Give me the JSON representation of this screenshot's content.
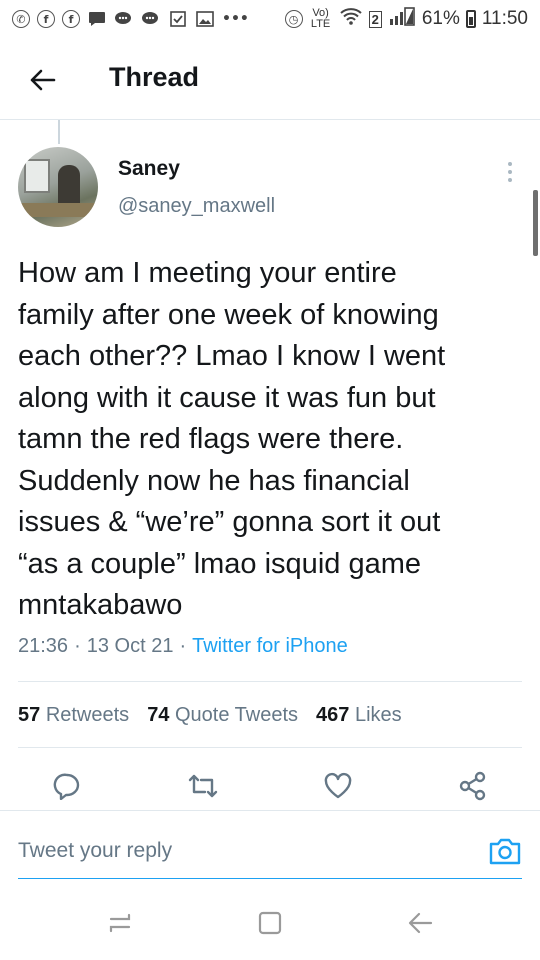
{
  "status_bar": {
    "battery_percent": "61%",
    "time": "11:50",
    "network_label": "Vo) LTE",
    "wifi_badge": "2",
    "overflow": "•••",
    "icons": [
      "whatsapp-icon",
      "facebook-icon",
      "facebook-icon",
      "message-icon",
      "chat-icon",
      "chat-icon",
      "checkbox-icon",
      "gallery-icon",
      "overflow-dots",
      "alarm-icon",
      "volte-icon",
      "wifi-icon",
      "signal-icon",
      "battery-icon"
    ]
  },
  "header": {
    "title": "Thread",
    "back_icon": "arrow-left-icon"
  },
  "tweet": {
    "author_name": "Saney",
    "author_handle": "@saney_maxwell",
    "text": "How am I meeting your entire\nfamily after one week of knowing\neach other?? Lmao I know I went\nalong with it cause it was fun but\ntamn the red flags were there.\nSuddenly now he has financial\nissues & “we’re” gonna sort it out\n“as a couple” lmao isquid game\nmntakabawo",
    "time": "21:36",
    "separator": "·",
    "date": "13 Oct 21",
    "source": "Twitter for iPhone"
  },
  "stats": {
    "retweets_count": "57",
    "retweets_label": "Retweets",
    "quotes_count": "74",
    "quotes_label": "Quote Tweets",
    "likes_count": "467",
    "likes_label": "Likes"
  },
  "actions": [
    "reply-icon",
    "retweet-icon",
    "like-icon",
    "share-icon"
  ],
  "reply": {
    "placeholder": "Tweet your reply"
  },
  "colors": {
    "accent": "#1da1f2",
    "text": "#14171a",
    "secondary": "#657786",
    "divider": "#e1e8ed"
  }
}
